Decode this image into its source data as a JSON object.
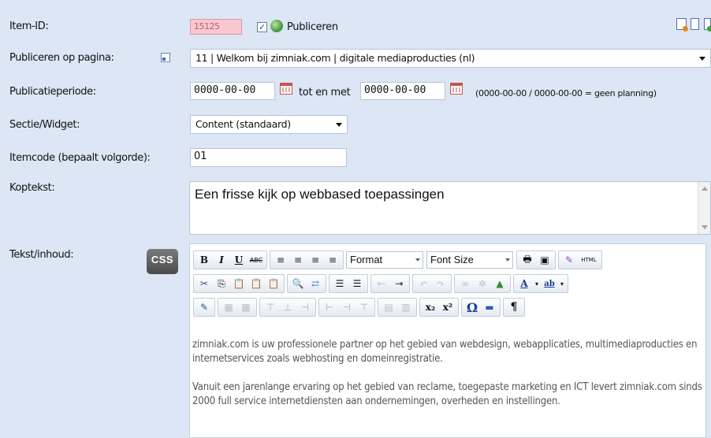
{
  "labels": {
    "item_id": "Item-ID:",
    "publish_page": "Publiceren op pagina:",
    "period": "Publicatieperiode:",
    "section": "Sectie/Widget:",
    "itemcode": "Itemcode (bepaalt volgorde):",
    "heading": "Koptekst:",
    "body": "Tekst/inhoud:"
  },
  "item_id_value": "15125",
  "publish_checkbox": "✓",
  "publish_label": "Publiceren",
  "publish_page_value": "11 | Welkom bij zimniak.com | digitale mediaproducties (nl)",
  "period": {
    "from": "0000-00-00",
    "to_label": "tot en met",
    "to": "0000-00-00",
    "hint": "(0000-00-00 / 0000-00-00 = geen planning)"
  },
  "section_value": "Content (standaard)",
  "itemcode_value": "01",
  "heading_value": "Een frisse kijk op webbased toepassingen",
  "css_button": "CSS",
  "editor": {
    "format_label": "Format",
    "fontsize_label": "Font Size",
    "html_label": "HTML",
    "bold": "B",
    "italic": "I",
    "underline": "U",
    "strike": "ABC",
    "sub": "x₂",
    "sup": "x²",
    "omega": "Ω",
    "pilcrow": "¶",
    "paragraphs": [
      "zimniak.com is uw professionele partner op het gebied van webdesign, webapplicaties, multimediaproducties en internetservices zoals webhosting en domeinregistratie.",
      "Vanuit een jarenlange ervaring op het gebied van reclame, toegepaste marketing en ICT levert zimniak.com sinds 2000 full service internetdiensten aan ondernemingen, overheden en instellingen."
    ]
  },
  "colors": {
    "panel_bg": "#dce6f4",
    "itemid_bg": "#f9c7cf"
  }
}
